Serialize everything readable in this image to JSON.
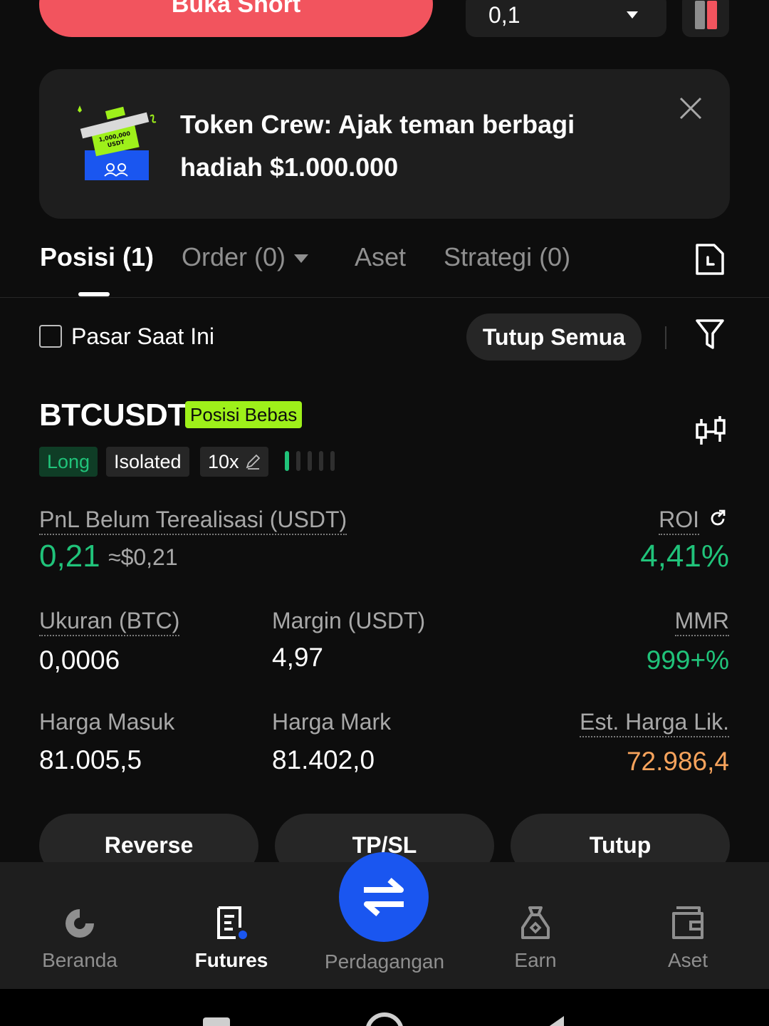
{
  "order_bar": {
    "open_short_label": "Buka Short",
    "quantity_value": "0,1"
  },
  "banner": {
    "art_text": "1,000,000 USDT",
    "title": "Token Crew: Ajak teman berbagi hadiah $1.000.000"
  },
  "tabs": [
    {
      "label": "Posisi (1)"
    },
    {
      "label": "Order (0)"
    },
    {
      "label": "Aset"
    },
    {
      "label": "Strategi (0)"
    }
  ],
  "filter": {
    "current_market_label": "Pasar Saat Ini",
    "close_all_label": "Tutup Semua"
  },
  "position": {
    "symbol": "BTCUSDT",
    "badge": "Posisi Bebas",
    "direction": "Long",
    "margin_mode": "Isolated",
    "leverage": "10x",
    "risk_level": 1,
    "pnl_label": "PnL Belum Terealisasi (USDT)",
    "pnl_value": "0,21",
    "pnl_usd": "≈$0,21",
    "roi_label": "ROI",
    "roi_value": "4,41%",
    "size_label": "Ukuran (BTC)",
    "size_value": "0,0006",
    "margin_label": "Margin (USDT)",
    "margin_value": "4,97",
    "mmr_label": "MMR",
    "mmr_value": "999+%",
    "entry_label": "Harga Masuk",
    "entry_value": "81.005,5",
    "mark_label": "Harga Mark",
    "mark_value": "81.402,0",
    "liq_label": "Est. Harga Lik.",
    "liq_value": "72.986,4"
  },
  "actions": {
    "reverse_label": "Reverse",
    "tpsl_label": "TP/SL",
    "close_label": "Tutup"
  },
  "nav": {
    "home": "Beranda",
    "futures": "Futures",
    "trade": "Perdagangan",
    "earn": "Earn",
    "assets": "Aset"
  },
  "colors": {
    "positive": "#20c37a",
    "short": "#f2545e",
    "liquidation": "#f7a35c",
    "badge": "#9ef01a",
    "accent": "#1a56f0"
  }
}
